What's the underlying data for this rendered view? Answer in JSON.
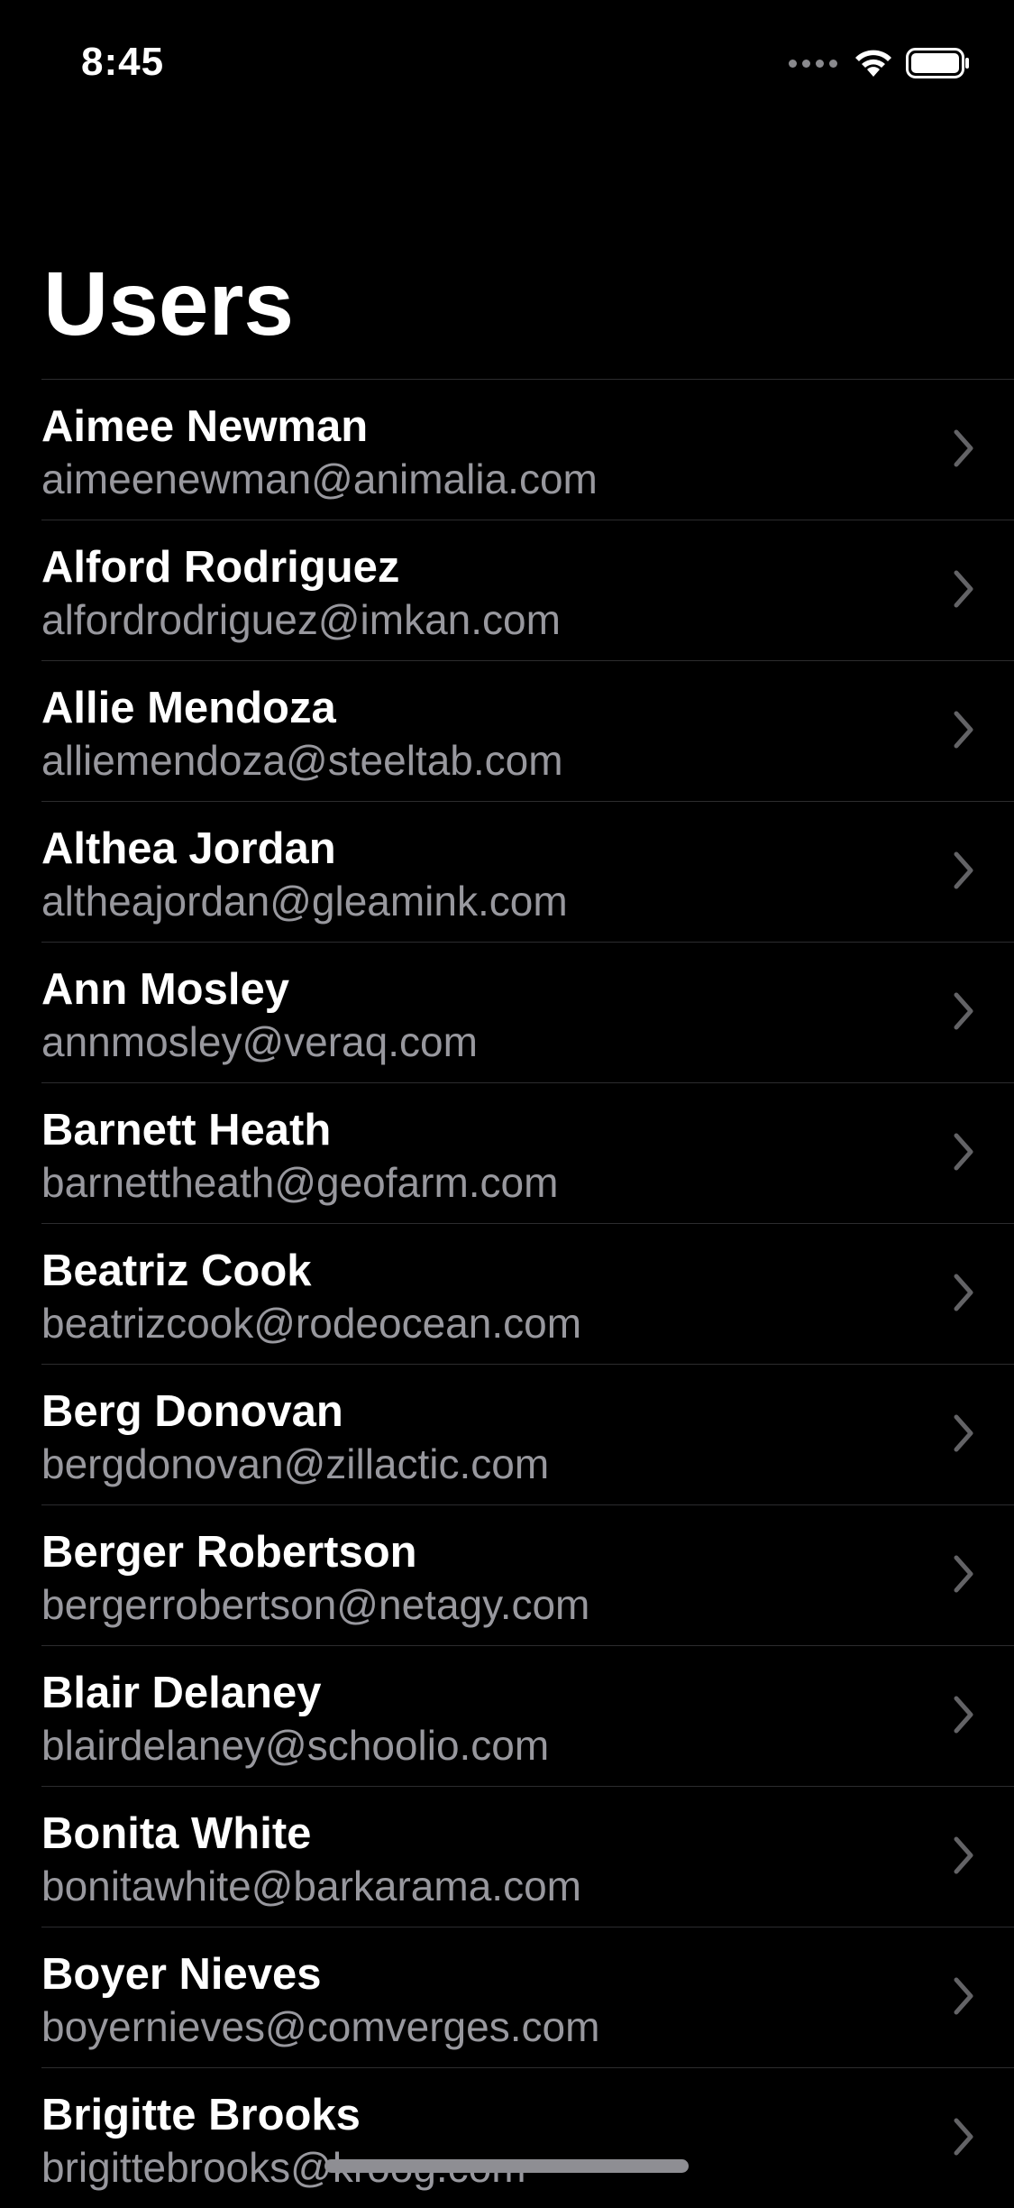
{
  "status_bar": {
    "time": "8:45"
  },
  "header": {
    "title": "Users"
  },
  "colors": {
    "background": "#000000",
    "primary_text": "#ffffff",
    "secondary_text": "#98989e",
    "separator": "#2c2c2e",
    "chevron": "#636366"
  },
  "users": [
    {
      "name": "Aimee Newman",
      "email": "aimeenewman@animalia.com"
    },
    {
      "name": "Alford Rodriguez",
      "email": "alfordrodriguez@imkan.com"
    },
    {
      "name": "Allie Mendoza",
      "email": "alliemendoza@steeltab.com"
    },
    {
      "name": "Althea Jordan",
      "email": "altheajordan@gleamink.com"
    },
    {
      "name": "Ann Mosley",
      "email": "annmosley@veraq.com"
    },
    {
      "name": "Barnett Heath",
      "email": "barnettheath@geofarm.com"
    },
    {
      "name": "Beatriz Cook",
      "email": "beatrizcook@rodeocean.com"
    },
    {
      "name": "Berg Donovan",
      "email": "bergdonovan@zillactic.com"
    },
    {
      "name": "Berger Robertson",
      "email": "bergerrobertson@netagy.com"
    },
    {
      "name": "Blair Delaney",
      "email": "blairdelaney@schoolio.com"
    },
    {
      "name": "Bonita White",
      "email": "bonitawhite@barkarama.com"
    },
    {
      "name": "Boyer Nieves",
      "email": "boyernieves@comverges.com"
    },
    {
      "name": "Brigitte Brooks",
      "email": "brigittebrooks@kroog.com"
    }
  ]
}
